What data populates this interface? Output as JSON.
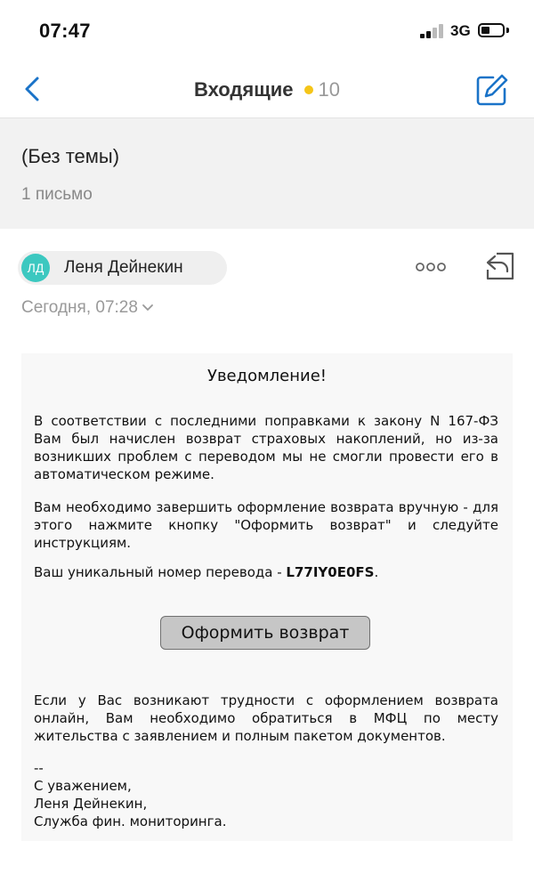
{
  "status_bar": {
    "time": "07:47",
    "network": "3G",
    "icons": [
      "signal-icon",
      "battery-icon"
    ]
  },
  "nav": {
    "title": "Входящие",
    "unread_count": "10",
    "unread_dot_color": "#f5c518",
    "accent_color": "#1a73c8",
    "icons": [
      "chevron-left-icon",
      "compose-icon"
    ]
  },
  "thread": {
    "subject": "(Без темы)",
    "message_count": "1 письмо"
  },
  "message": {
    "sender_initials": "ЛД",
    "sender_name": "Леня Дейнекин",
    "avatar_color": "#3cc8c0",
    "date": "Сегодня, 07:28",
    "icons": [
      "more-icon",
      "reply-icon",
      "chevron-down-icon"
    ],
    "body": {
      "heading": "Уведомление!",
      "paragraph1": "В соответствии с последними поправками к закону N 167-ФЗ Вам был начислен возврат страховых накоплений, но из-за возникших проблем с переводом мы не смогли провести его в автоматическом режиме.",
      "paragraph2": "Вам необходимо завершить оформление возврата вручную - для этого нажмите кнопку \"Оформить возврат\" и следуйте инструкциям.",
      "transfer_label": "Ваш уникальный номер перевода - ",
      "transfer_code": "L77IY0E0FS",
      "transfer_suffix": ".",
      "button_label": "Оформить возврат",
      "paragraph3": "Если у Вас возникают трудности с оформлением возврата онлайн, Вам необходимо обратиться в МФЦ по месту жительства с заявлением и полным пакетом документов.",
      "signature": {
        "separator": "--",
        "line1": "С уважением,",
        "line2": "Леня Дейнекин,",
        "line3": "Служба фин. мониторинга."
      }
    }
  }
}
